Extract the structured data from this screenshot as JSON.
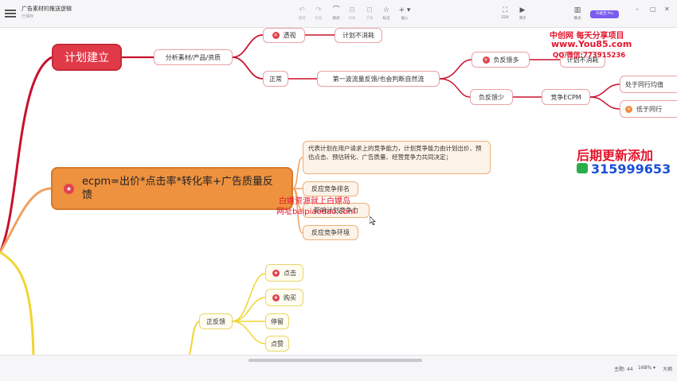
{
  "window": {
    "title": "广告素材的推送逻辑",
    "subtitle": "已保存"
  },
  "toolbar": {
    "undo": {
      "label": "撤销",
      "icon": "undo-icon"
    },
    "redo": {
      "label": "恢复",
      "icon": "redo-icon"
    },
    "format": {
      "label": "格式",
      "icon": "format-brush-icon"
    },
    "sibling": {
      "label": "同级",
      "icon": "sibling-icon"
    },
    "child": {
      "label": "子级",
      "icon": "child-icon"
    },
    "mark": {
      "label": "标记",
      "icon": "star-icon"
    },
    "insert": {
      "label": "插入",
      "icon": "plus-icon"
    },
    "zen": {
      "label": "ZEN",
      "icon": "fullscreen-icon"
    },
    "present": {
      "label": "演示",
      "icon": "play-icon"
    },
    "layout": {
      "label": "模式",
      "icon": "layout-icon"
    },
    "pro": "升级至 Pro"
  },
  "mindmap": {
    "plan": "计划建立",
    "analyze": "分析素材/产品/资质",
    "abnormal": "透视",
    "not_consume_1": "计划不消耗",
    "normal": "正常",
    "first_traffic": "第一波流量反馈/也会判断自然流",
    "neg_more": "负反馈多",
    "not_consume_2": "计划不消耗",
    "neg_less": "负反馈少",
    "compete_ecpm": "竞争ECPM",
    "peer_avg": "处于同行均值",
    "below_peer": "低于同行",
    "ecpm_formula": "ecpm=出价*点击率*转化率+广告质量反馈",
    "ecpm_desc": "代表计划在用户请求上的竞争能力，计划竞争能力由计划出价、预估点击、预估转化、广告质量、经营竞争力共同决定；",
    "rank": "反应竞争排名",
    "ability": "影响计划竞争力",
    "env": "反应竞争环境",
    "pos_feedback": "正反馈",
    "click": "点击",
    "buy": "购买",
    "stay": "停留",
    "like": "点赞"
  },
  "watermarks": {
    "site1": "中创网 每天分享项目",
    "site2": "www.You85.com",
    "site3": "QQ/微信:773915236",
    "update": "后期更新添加",
    "wechat": "315999653",
    "bj1": "白嫖资源就上白嫖岛",
    "bj2": "网址baipiaodao.com"
  },
  "status": {
    "topics_label": "主题:",
    "topics": "44",
    "zoom": "168%",
    "size_label": "大纲"
  },
  "colors": {
    "red_branch": "#c8102e",
    "orange_branch": "#f0a060",
    "yellow_branch": "#f2d531",
    "red_node": "#e03a48",
    "orange_node": "#ee9240",
    "pro": "#7a5cf0",
    "watermark_red": "#e3142b",
    "watermark_blue": "#1b4fd6"
  }
}
